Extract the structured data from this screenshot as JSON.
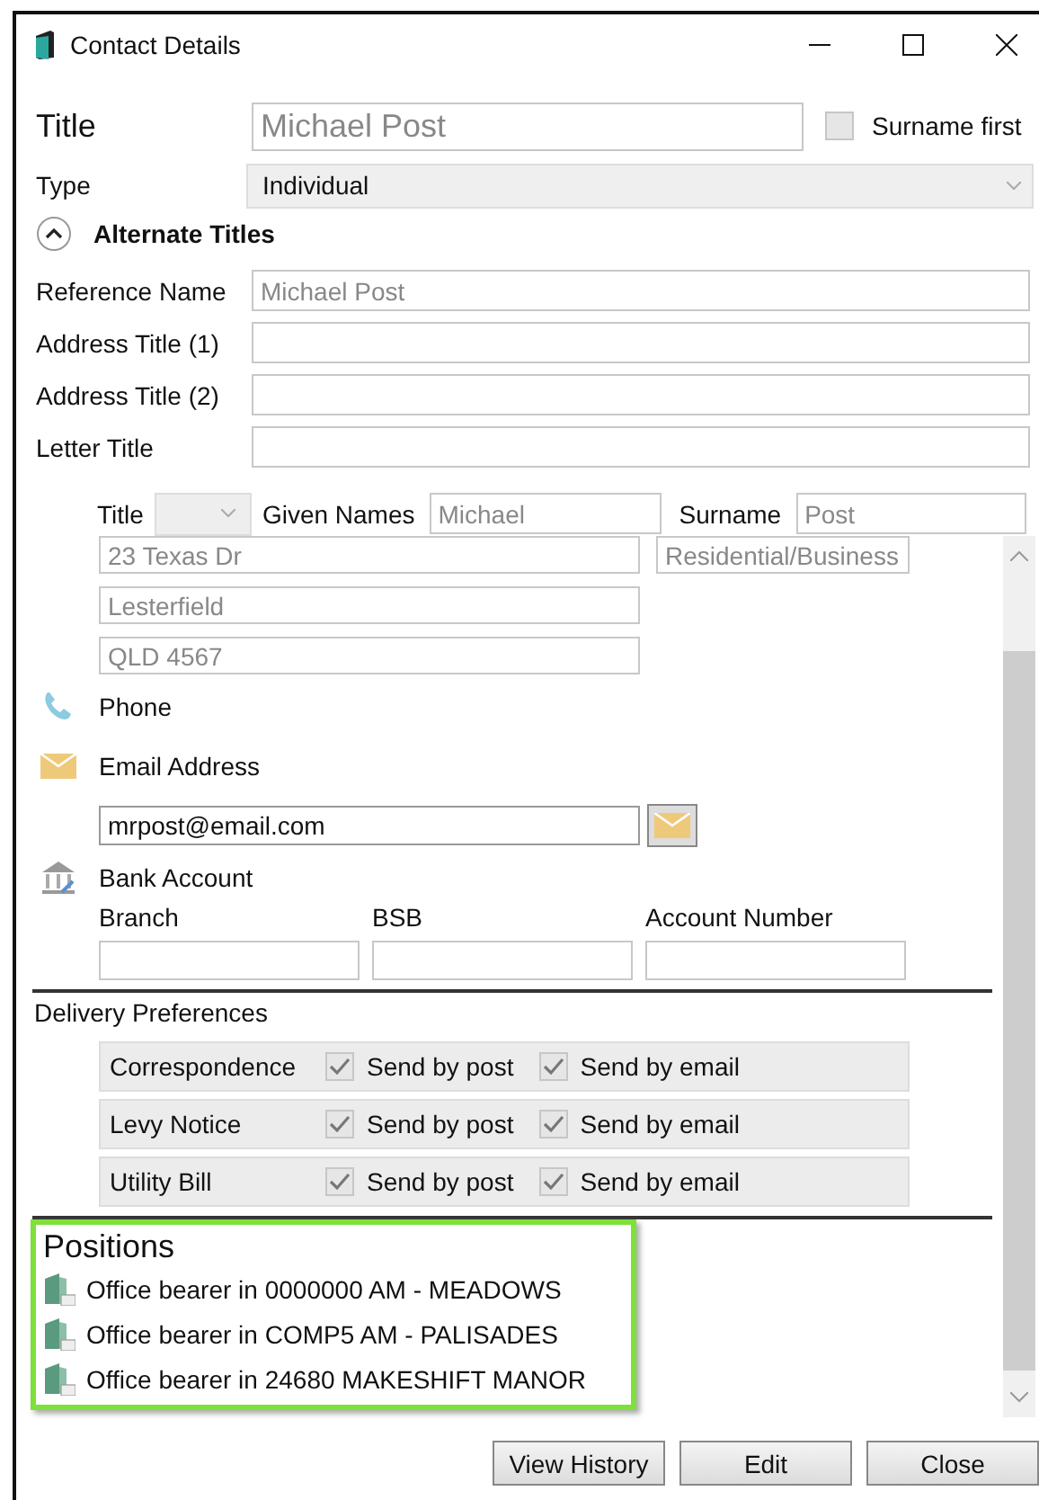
{
  "window": {
    "title": "Contact Details"
  },
  "title_field": {
    "label": "Title",
    "value": "Michael Post"
  },
  "surname_first": {
    "label": "Surname first",
    "checked": false
  },
  "type_field": {
    "label": "Type",
    "value": "Individual"
  },
  "alternate_titles": {
    "label": "Alternate Titles",
    "expanded": true,
    "fields": [
      {
        "label": "Reference Name",
        "value": "Michael Post"
      },
      {
        "label": "Address Title (1)"
      },
      {
        "label": "Address Title (2)"
      },
      {
        "label": "Letter Title"
      }
    ]
  },
  "name_row": {
    "title_label": "Title",
    "given_label": "Given Names",
    "given_value": "Michael",
    "surname_label": "Surname",
    "surname_value": "Post"
  },
  "address": {
    "lines": [
      "23 Texas Dr",
      "Lesterfield",
      "QLD 4567"
    ],
    "address_type": "Residential/Business"
  },
  "phone": {
    "label": "Phone"
  },
  "email": {
    "label": "Email Address",
    "value": "mrpost@email.com"
  },
  "bank": {
    "label": "Bank Account",
    "columns": [
      "Branch",
      "BSB",
      "Account Number"
    ]
  },
  "delivery": {
    "label": "Delivery Preferences",
    "rows": [
      {
        "name": "Correspondence",
        "post_label": "Send by post",
        "post": true,
        "email_label": "Send by email",
        "email": true
      },
      {
        "name": "Levy Notice",
        "post_label": "Send by post",
        "post": true,
        "email_label": "Send by email",
        "email": true
      },
      {
        "name": "Utility Bill",
        "post_label": "Send by post",
        "post": true,
        "email_label": "Send by email",
        "email": true
      }
    ]
  },
  "positions": {
    "label": "Positions",
    "items": [
      "Office bearer in 0000000 AM - MEADOWS",
      "Office bearer in COMP5 AM - PALISADES",
      "Office bearer in 24680 MAKESHIFT  MANOR"
    ]
  },
  "buttons": [
    "View History",
    "Edit",
    "Close"
  ]
}
